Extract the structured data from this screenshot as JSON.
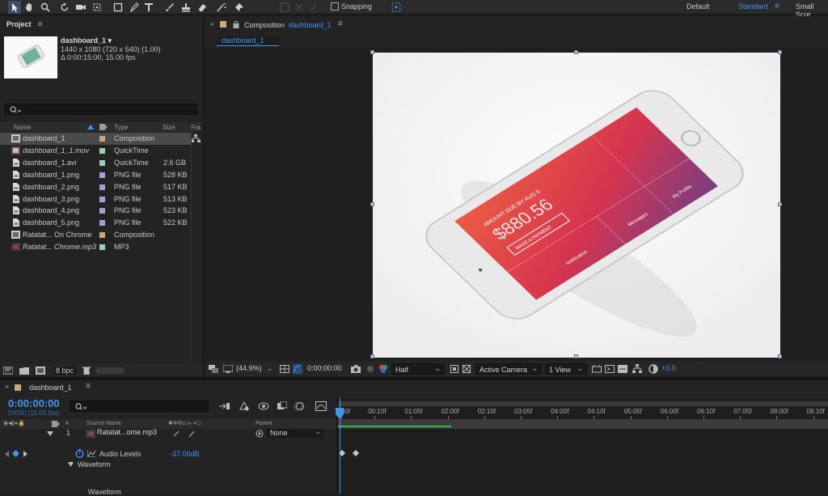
{
  "workspaces": {
    "default": "Default",
    "standard": "Standard",
    "small": "Small Scre"
  },
  "toolbar": {
    "snapping": "Snapping"
  },
  "project": {
    "title": "Project",
    "selected_name": "dashboard_1 ▾",
    "selected_dims": "1440 x 1080  (720 x 540) (1.00)",
    "selected_dur": "Δ 0:00:15:00, 15.00 fps",
    "search_placeholder": "",
    "columns": {
      "name": "Name",
      "type": "Type",
      "size": "Size",
      "frame": "Fra"
    },
    "items": [
      {
        "name": "dashboard_1",
        "type": "Composition",
        "size": "",
        "label": "#c9a77a",
        "icon": "composition-icon",
        "italic": false
      },
      {
        "name": "dashboard_1_1.mov",
        "type": "QuickTime",
        "size": "",
        "label": "#9ecdb8",
        "icon": "quicktime-icon",
        "italic": true
      },
      {
        "name": "dashboard_1.avi",
        "type": "QuickTime",
        "size": "2.6 GB",
        "label": "#9ecdb8",
        "icon": "file-icon",
        "italic": false
      },
      {
        "name": "dashboard_1.png",
        "type": "PNG file",
        "size": "528 KB",
        "label": "#a89ed4",
        "icon": "file-icon",
        "italic": false
      },
      {
        "name": "dashboard_2.png",
        "type": "PNG file",
        "size": "517 KB",
        "label": "#a89ed4",
        "icon": "file-icon",
        "italic": false
      },
      {
        "name": "dashboard_3.png",
        "type": "PNG file",
        "size": "513 KB",
        "label": "#a89ed4",
        "icon": "file-icon",
        "italic": false
      },
      {
        "name": "dashboard_4.png",
        "type": "PNG file",
        "size": "523 KB",
        "label": "#a89ed4",
        "icon": "file-icon",
        "italic": false
      },
      {
        "name": "dashboard_5.png",
        "type": "PNG file",
        "size": "522 KB",
        "label": "#a89ed4",
        "icon": "file-icon",
        "italic": false
      },
      {
        "name": "Ratatat... On Chrome",
        "type": "Composition",
        "size": "",
        "label": "#c9a77a",
        "icon": "composition-icon",
        "italic": false
      },
      {
        "name": "Ratatat... Chrome.mp3",
        "type": "MP3",
        "size": "",
        "label": "#9ecdb8",
        "icon": "audio-icon",
        "italic": true
      }
    ],
    "bpc": "8 bpc"
  },
  "comp": {
    "tab_title": "Composition",
    "tab_name": "dashboard_1",
    "sub_tab": "dashboard_1",
    "zoom": "(44.9%)",
    "timecode": "0:00:00:00",
    "resolution": "Half",
    "camera": "Active Camera",
    "views": "1 View",
    "exposure": "+0.0"
  },
  "phone": {
    "amount_label": "AMOUNT DUE BY AUG 5",
    "amount": "$880.56",
    "button": "MAKE A PAYMENT",
    "menu": [
      "Messages",
      "My Profile",
      "Notification",
      "Support"
    ]
  },
  "timeline": {
    "tab": "dashboard_1",
    "timecode": "0:00:00:00",
    "timecode_sub": "00000 (15.00 fps)",
    "col_source": "Source Name",
    "col_parent": "Parent",
    "layer_num": "1",
    "layer_name": "Ratatat...ome.mp3",
    "parent_value": "None",
    "prop_name": "Audio Levels",
    "prop_value": "-37.00dB",
    "waveform": "Waveform",
    "waveform2": "Waveform",
    "ruler": [
      "00f",
      "00:10f",
      "01:05f",
      "02:00f",
      "02:10f",
      "03:05f",
      "04:00f",
      "04:10f",
      "05:05f",
      "06:00f",
      "06:10f",
      "07:05f",
      "08:00f",
      "08:10f"
    ]
  },
  "colors": {
    "accent": "#3f97f1",
    "panel": "#232323",
    "toolbar": "#2b2b2b",
    "selection": "#4a4a4a",
    "phone_gradient_top": "#e5473a",
    "phone_gradient_bottom": "#7b3b7e"
  }
}
